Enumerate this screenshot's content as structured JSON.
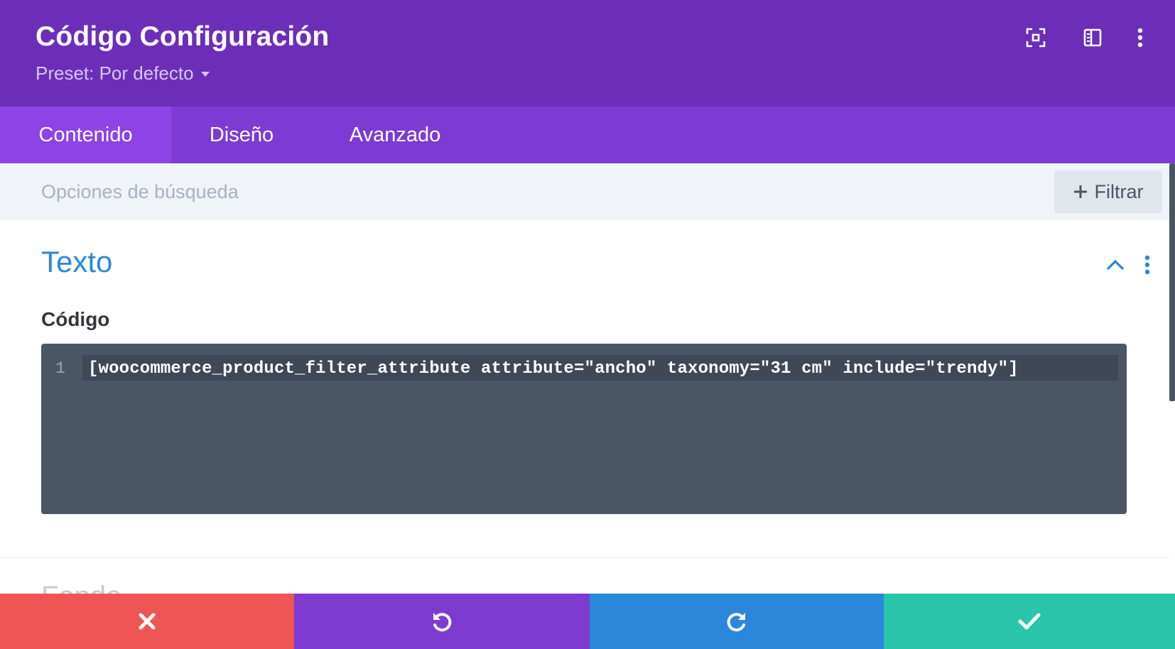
{
  "header": {
    "title": "Código Configuración",
    "preset_label": "Preset: Por defecto",
    "icons": [
      "expand-focus-icon",
      "sidebar-layout-icon",
      "more-vertical-icon"
    ],
    "background": "#6c2eb9"
  },
  "tabs": [
    {
      "label": "Contenido",
      "active": true
    },
    {
      "label": "Diseño",
      "active": false
    },
    {
      "label": "Avanzado",
      "active": false
    }
  ],
  "search": {
    "placeholder": "Opciones de búsqueda",
    "filter_label": "Filtrar"
  },
  "section": {
    "title": "Texto",
    "expanded": true,
    "field_label": "Código",
    "code": {
      "line_number": "1",
      "content": "[woocommerce_product_filter_attribute attribute=\"ancho\" taxonomy=\"31 cm\" include=\"trendy\"]"
    }
  },
  "next_section": {
    "title": "Fondo"
  },
  "footer": {
    "buttons": [
      {
        "name": "cancel",
        "icon": "close-icon",
        "color": "#ef5555"
      },
      {
        "name": "undo",
        "icon": "undo-icon",
        "color": "#7e3bd0"
      },
      {
        "name": "redo",
        "icon": "redo-icon",
        "color": "#2b87da"
      },
      {
        "name": "save",
        "icon": "check-icon",
        "color": "#29c4a9"
      }
    ]
  },
  "colors": {
    "accent_blue": "#2b87da",
    "tab_bar": "#7d3bd4",
    "tab_active": "#8e43e7",
    "editor_bg": "#4a5666"
  }
}
